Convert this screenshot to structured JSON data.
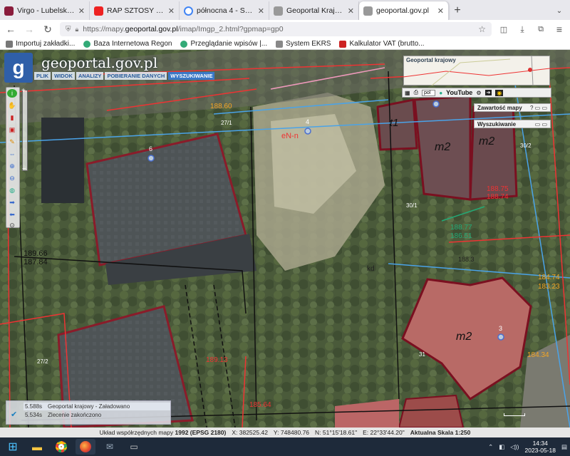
{
  "browser": {
    "tabs": [
      {
        "title": "Virgo - Lubelskie Nieruchom",
        "color": "#8a1c3c"
      },
      {
        "title": "RAP SZTOSY 2022 VOL.",
        "color": "#e22"
      },
      {
        "title": "północna 4 - Szukaj w Goo",
        "color": "#4285f4"
      },
      {
        "title": "Geoportal Krajowy - Geopo",
        "color": "#555"
      },
      {
        "title": "geoportal.gov.pl",
        "color": "#555",
        "active": true
      }
    ],
    "url_prefix": "https://mapy.",
    "url_domain": "geoportal.gov.pl",
    "url_rest": "/imap/Imgp_2.html?gpmap=gp0",
    "bookmarks": [
      {
        "label": "Importuj zakładki...",
        "color": "#6a6a6a"
      },
      {
        "label": "Baza Internetowa Regon",
        "color": "#3a7"
      },
      {
        "label": "Przeglądanie wpisów |...",
        "color": "#3a7"
      },
      {
        "label": "System EKRS",
        "color": "#888"
      },
      {
        "label": "Kalkulator VAT (brutto...",
        "color": "#c22"
      }
    ]
  },
  "geoportal": {
    "logo": "geoportal.gov.pl",
    "menu": [
      "PLIK",
      "WIDOK",
      "ANALIZY",
      "POBIERANIE DANYCH",
      "WYSZUKIWANIE"
    ],
    "overview_title": "Geoportal krajowy",
    "lang": "pol",
    "youtube": "YouTube",
    "panels": [
      "Zawartość mapy",
      "Wyszukiwanie"
    ],
    "parcels": [
      "t1",
      "m2",
      "m2",
      "m2"
    ],
    "labels": [
      "6",
      "4",
      "3",
      "27/1",
      "30/2",
      "30/1",
      "27/2",
      "31",
      "eN-n",
      "kd",
      "188.60",
      "188.75",
      "189.66",
      "187.84",
      "189.13",
      "188.77",
      "186.51",
      "188.3",
      "184.74",
      "183.23",
      "184.34",
      "185.64",
      "188.74"
    ],
    "load_rows": [
      {
        "time": "5.588s",
        "text": "Geoportal krajowy - Załadowano"
      },
      {
        "time": "5.534s",
        "text": "Zlecenie zakończono"
      }
    ]
  },
  "status": {
    "crs_label": "Układ współrzędnych mapy",
    "crs_value": "1992 (EPSG 2180)",
    "x": "X: 382525.42",
    "y": "Y: 748480.76",
    "n": "N: 51°15'18.61\"",
    "e": "E: 22°33'44.20\"",
    "scale": "Aktualna Skala 1:250"
  },
  "taskbar": {
    "time": "14:34",
    "date": "2023-05-18"
  }
}
